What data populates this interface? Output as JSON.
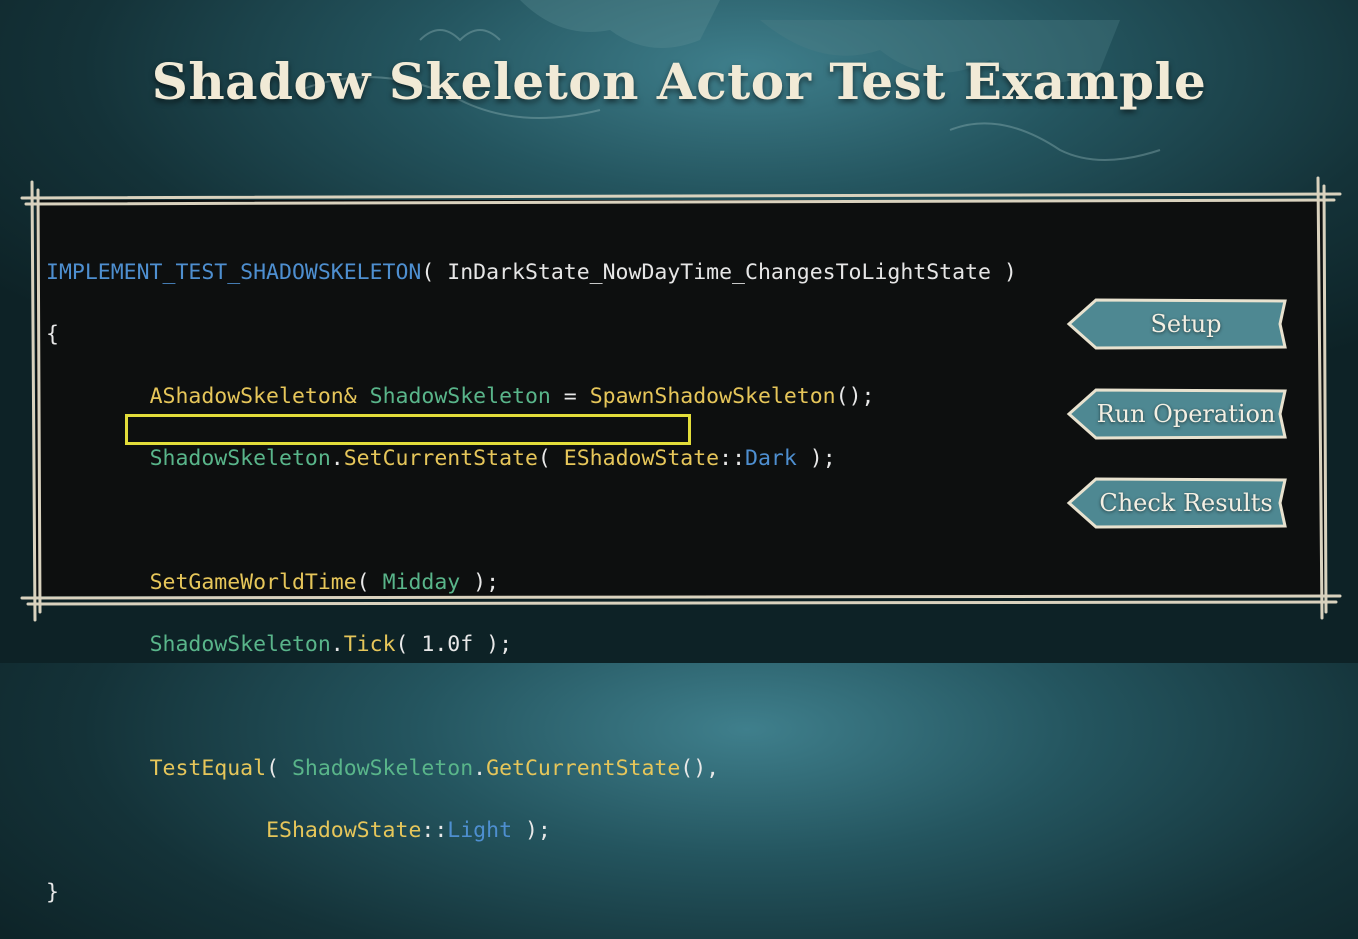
{
  "slide": {
    "title": "Shadow Skeleton Actor Test Example"
  },
  "code": {
    "macro": "IMPLEMENT_TEST_SHADOWSKELETON",
    "test_name": "InDarkState_NowDayTime_ChangesToLightState",
    "open_brace": "{",
    "close_brace": "}",
    "type_ref": "AShadowSkeleton&",
    "var": "ShadowSkeleton",
    "spawn_fn": "SpawnShadowSkeleton",
    "set_state_fn": "SetCurrentState",
    "enum_type": "EShadowState",
    "enum_dark": "Dark",
    "set_time_fn": "SetGameWorldTime",
    "midday": "Midday",
    "tick_fn": "Tick",
    "tick_arg": "1.0f",
    "test_equal_fn": "TestEqual",
    "get_state_fn": "GetCurrentState",
    "enum_light": "Light"
  },
  "steps": {
    "setup": "Setup",
    "run_operation": "Run Operation",
    "check_results": "Check Results"
  },
  "colors": {
    "highlight": "#e2dd3a",
    "macro": "#4e8fd0",
    "type": "#e6c65a",
    "variable": "#59b58a"
  }
}
